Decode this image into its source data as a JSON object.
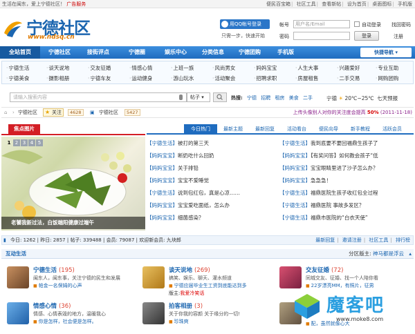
{
  "topbar": {
    "left": "生活在闽东，爱上宁德社区！",
    "ad": "广告服务",
    "links": [
      "便民百宝箱",
      "社区工具",
      "查看新帖",
      "设为首页",
      "桌面图标",
      "手机版"
    ]
  },
  "logo": {
    "name": "宁德社区",
    "url": "www.ndsq.cn"
  },
  "qq": {
    "button": "用QQ帐号登录",
    "hint": "只需一步，快速开始"
  },
  "login": {
    "username_label": "帐号",
    "username_placeholder": "用户名/Email",
    "password_label": "密码",
    "auto_login": "自动登录",
    "find_password": "找回密码",
    "submit": "登录",
    "register": "注册"
  },
  "nav": {
    "items": [
      "全站首页",
      "宁德社区",
      "接街评点",
      "宁德圈",
      "娱乐中心",
      "分类信息",
      "宁德团购",
      "手机版"
    ],
    "quick": "快捷导航"
  },
  "subnav": {
    "row1": [
      "宁德生活",
      "谈天说地",
      "交友征婚",
      "情感心情",
      "上班一族",
      "风尚男女",
      "妈妈宝宝",
      "人生大事",
      "兴趣爱好",
      "专业互助"
    ],
    "row2": [
      "宁德美食",
      "摄影相册",
      "宁德车友",
      "运动健身",
      "游山玩水",
      "活动聚会",
      "招聘求职",
      "房屋租售",
      "二手交易",
      "网购团购"
    ]
  },
  "search": {
    "placeholder": "请输入搜索内容",
    "type": "帖子",
    "hot_label": "热搜:",
    "hot": [
      "宁德",
      "招聘",
      "租房",
      "美食",
      "二手"
    ]
  },
  "weather": {
    "city": "宁德",
    "temp": "20℃~25℃",
    "desc": "七天预报"
  },
  "crumbs": {
    "home": "宁德社区",
    "follow": "关注",
    "follow_count": "4628",
    "forum": "宁德社区",
    "forum_count": "5427",
    "vote_text": "上传头像别人对你的关注度会提高",
    "vote_pct": "50%",
    "vote_date": "(2011-11-18)"
  },
  "focus": {
    "title": "焦点图片",
    "pages": [
      "1",
      "2",
      "3",
      "4",
      "5"
    ],
    "caption": "老饕我新过法，白饭端阳健康过端午"
  },
  "tabs": [
    "今日热门",
    "最新主题",
    "最新回复",
    "活动看台",
    "便民向导",
    "新手教程",
    "活跃会员"
  ],
  "posts_left": [
    {
      "tag": "【宁德生活】",
      "title": "被打的第三天"
    },
    {
      "tag": "【妈妈宝宝】",
      "title": "断奶吃什么回奶"
    },
    {
      "tag": "【妈妈宝宝】",
      "title": "关于排铅"
    },
    {
      "tag": "【妈妈宝宝】",
      "title": "宝宝不爱睡觉"
    },
    {
      "tag": "【宁德生活】",
      "title": "说到包红包，真是心凉……"
    },
    {
      "tag": "【妈妈宝宝】",
      "title": "宝宝爱吃面纸，怎么办"
    },
    {
      "tag": "【妈妈宝宝】",
      "title": "细菌感染？"
    }
  ],
  "posts_right": [
    {
      "tag": "【宁德生活】",
      "title": "我到底要不要回福鼎生孩子了"
    },
    {
      "tag": "【妈妈宝宝】",
      "title": "【有奖问答】如何教会孩子“低"
    },
    {
      "tag": "【妈妈宝宝】",
      "title": "宝宝眼睛里进了沙子怎么办？"
    },
    {
      "tag": "【妈妈宝宝】",
      "title": "急急急！"
    },
    {
      "tag": "【宁德生活】",
      "title": "福鼎医院生孩子收红包全过程"
    },
    {
      "tag": "【宁德生活】",
      "title": "福鼎医院 事故多发区？"
    },
    {
      "tag": "【宁德生活】",
      "title": "福鼎市医院的“白衣天使”"
    }
  ],
  "stats": {
    "today": "今日: 1262",
    "yesterday": "昨日: 2857",
    "posts": "帖子: 339488",
    "members": "会员: 79087",
    "welcome": "欢迎新会员: 九块郎",
    "links": [
      "最新回复",
      "邀请注册",
      "社区工具",
      "排行榜"
    ]
  },
  "section": {
    "title": "互动生活",
    "moderator_label": "分区版主:",
    "moderator": "神马都是浮云"
  },
  "forums": [
    {
      "name": "宁德生活",
      "count": "(195)",
      "desc": "闽东人，闽东事，关注宁德的民生和发展",
      "latest": "帕金一名保姆的心声",
      "red": ""
    },
    {
      "name": "谈天说地",
      "count": "(269)",
      "desc": "搞笑、娱乐、聊天、灌水频道",
      "latest": "宁德应届毕业生工资到底能达到多",
      "red": "",
      "extra_label": "版主:",
      "extra": "我爱冷笑话"
    },
    {
      "name": "交友征婚",
      "count": "(72)",
      "desc": "同城交友、征婚、找一个人陪你看",
      "latest": "22岁漂亮MM，有照片，征男",
      "red": ""
    },
    {
      "name": "情感心情",
      "count": "(36)",
      "desc": "情感、心情表毁的地方，温暖我心",
      "latest": "你是怎样，社会便是怎样。",
      "red": ""
    },
    {
      "name": "拍客相册",
      "count": "(3)",
      "desc": "关于你我的容颜 关于缘分的一切!",
      "latest": "珍珠爽",
      "red": ""
    },
    {
      "name": "",
      "count": "",
      "desc": "",
      "latest": "配，虽然就像心大",
      "red": ""
    }
  ],
  "watermark": {
    "title": "魔客吧",
    "url": "www.moke8.com"
  },
  "colors": {
    "primary": "#1f6cbf",
    "accent_red": "#d31e25",
    "link": "#1c66b0"
  }
}
